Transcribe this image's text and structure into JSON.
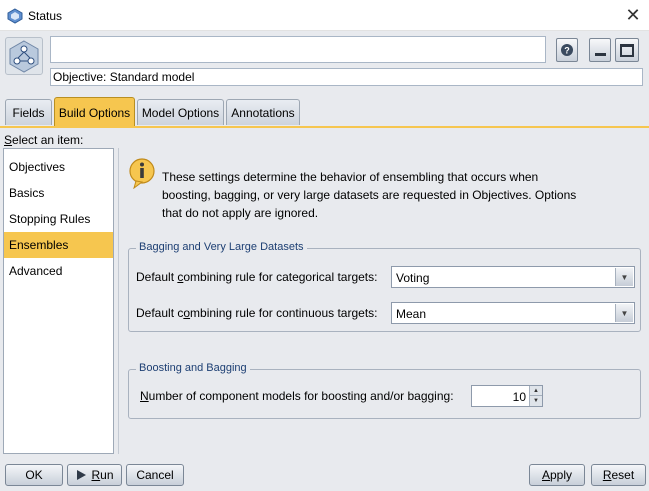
{
  "window": {
    "title": "Status"
  },
  "header": {
    "name_value": "",
    "objective": "Objective: Standard model"
  },
  "tabs": [
    {
      "label": "Fields"
    },
    {
      "label": "Build Options"
    },
    {
      "label": "Model Options"
    },
    {
      "label": "Annotations"
    }
  ],
  "left": {
    "select_label_prefix": "S",
    "select_label_rest": "elect an item:",
    "items": [
      {
        "label": "Objectives"
      },
      {
        "label": "Basics"
      },
      {
        "label": "Stopping Rules"
      },
      {
        "label": "Ensembles"
      },
      {
        "label": "Advanced"
      }
    ],
    "selected": "Ensembles"
  },
  "info": {
    "text": "These settings determine the behavior of ensembling that occurs when boosting, bagging, or very large datasets are requested in Objectives. Options that do not apply are ignored."
  },
  "group1": {
    "title": "Bagging and Very Large Datasets",
    "categorical": {
      "label_a": "Default ",
      "label_u": "c",
      "label_b": "ombining rule for categorical targets:",
      "value": "Voting"
    },
    "continuous": {
      "label_a": "Default c",
      "label_u": "o",
      "label_b": "mbining rule for continuous targets:",
      "value": "Mean"
    }
  },
  "group2": {
    "title": "Boosting and Bagging",
    "components": {
      "label_u": "N",
      "label_b": "umber of component models for boosting and/or bagging:",
      "value": "10"
    }
  },
  "buttons": {
    "ok": "OK",
    "run_u": "R",
    "run_rest": "un",
    "cancel": "Cancel",
    "apply_u": "A",
    "apply_rest": "pply",
    "reset_u": "R",
    "reset_rest": "eset"
  },
  "icons": {
    "app": "model-node-icon",
    "help": "help-icon",
    "minimize": "minimize-icon",
    "maximize": "maximize-icon",
    "info": "info-icon",
    "run": "run-arrow-icon"
  },
  "colors": {
    "accent": "#f6c64f",
    "background": "#e8eaee"
  }
}
